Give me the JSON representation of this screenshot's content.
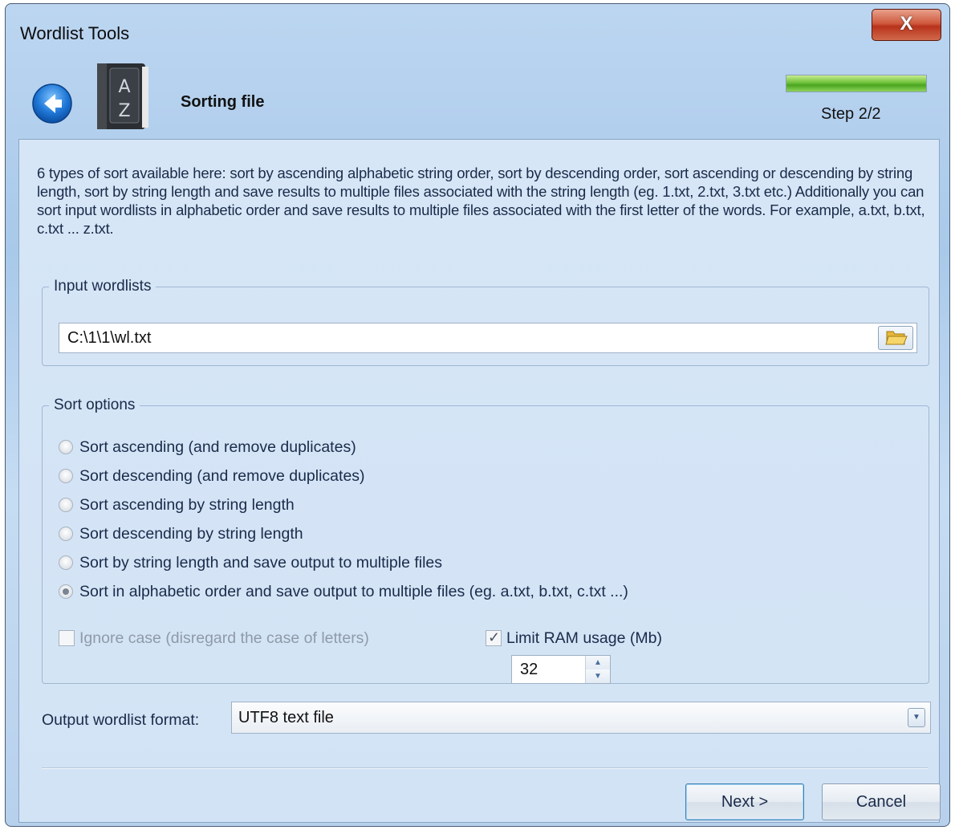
{
  "window": {
    "title": "Wordlist Tools",
    "close_label": "X"
  },
  "header": {
    "title": "Sorting file",
    "step": "Step 2/2",
    "progress": 1.0,
    "book_letters": [
      "A",
      "Z"
    ]
  },
  "description": "6 types of sort available here: sort by ascending alphabetic string order, sort by descending order, sort ascending or descending by string length, sort by string length and save results to multiple files associated with the string length (eg. 1.txt, 2.txt, 3.txt etc.) Additionally you can sort input wordlists in alphabetic order and save results to multiple files associated with the first letter of the words. For example, a.txt, b.txt, c.txt ... z.txt.",
  "input_group": {
    "legend": "Input wordlists",
    "value": "C:\\1\\1\\wl.txt",
    "browse_icon": "folder-open-icon"
  },
  "sort_group": {
    "legend": "Sort options",
    "options": [
      {
        "label": "Sort ascending (and remove duplicates)",
        "checked": false
      },
      {
        "label": "Sort descending (and remove duplicates)",
        "checked": false
      },
      {
        "label": "Sort ascending by string length",
        "checked": false
      },
      {
        "label": "Sort descending by string length",
        "checked": false
      },
      {
        "label": "Sort by string length and save output to multiple files",
        "checked": false
      },
      {
        "label": "Sort in alphabetic order and save output to multiple files (eg. a.txt, b.txt, c.txt ...)",
        "checked": true
      }
    ],
    "ignore_case": {
      "label": "Ignore case (disregard the case of letters)",
      "checked": false,
      "enabled": false
    },
    "limit_ram": {
      "label": "Limit RAM usage (Mb)",
      "checked": true,
      "value": "32"
    }
  },
  "output_format": {
    "label": "Output wordlist format:",
    "selected": "UTF8 text file"
  },
  "buttons": {
    "next_label": "Next >",
    "cancel_label": "Cancel"
  }
}
